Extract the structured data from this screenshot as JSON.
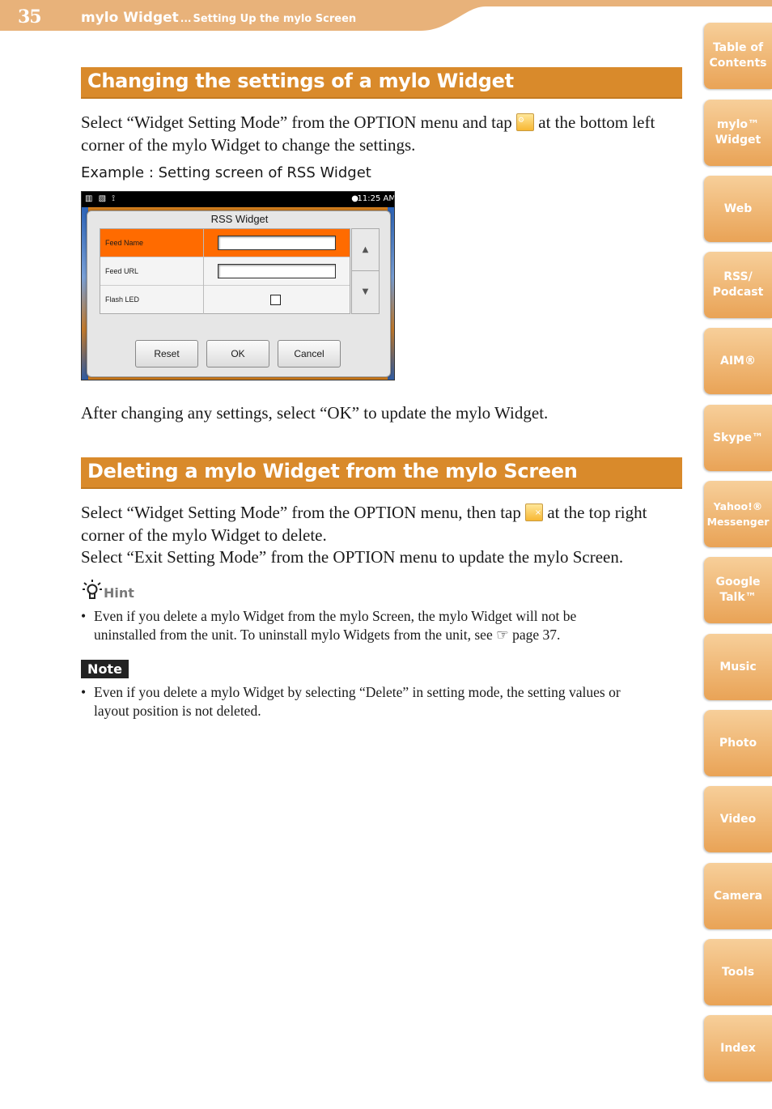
{
  "header": {
    "page_number": "35",
    "section": "mylo Widget",
    "separator": "...",
    "subsection": "Setting Up the mylo Screen"
  },
  "section1": {
    "title": "Changing the settings of a mylo Widget",
    "text_before_icon": "Select “Widget Setting Mode” from the OPTION menu and tap",
    "text_after_icon": "at the bottom left corner of the mylo Widget to change the settings.",
    "example_caption": "Example : Setting screen of RSS Widget",
    "after_text": "After changing any settings, select “OK” to update the mylo Widget."
  },
  "screenshot": {
    "status_icons": "▥ ▧ ⟟",
    "time": "11:25 AM",
    "chat_icon": "💬",
    "dialog_title": "RSS Widget",
    "rows": [
      {
        "label": "Feed Name",
        "selected": true
      },
      {
        "label": "Feed URL",
        "selected": false
      },
      {
        "label": "Flash LED",
        "selected": false
      }
    ],
    "scroll_up": "▲",
    "scroll_down": "▼",
    "buttons": {
      "reset": "Reset",
      "ok": "OK",
      "cancel": "Cancel"
    }
  },
  "section2": {
    "title": "Deleting a mylo Widget from the mylo Screen",
    "text_before_icon": "Select “Widget Setting Mode” from the OPTION menu, then tap",
    "text_after_icon": "at the top right corner of the mylo Widget to delete.",
    "text_line3": "Select “Exit Setting Mode” from the OPTION menu to update the mylo Screen."
  },
  "hint": {
    "label": "Hint",
    "bullet_line1": "Even if  you delete a mylo Widget from the mylo Screen, the mylo Widget will not be",
    "bullet_line2": "uninstalled from the unit. To uninstall mylo Widgets from the unit, see ☞ page 37."
  },
  "note": {
    "label": "Note",
    "bullet_line1": "Even if you delete a mylo Widget by selecting “Delete” in setting mode, the setting values or",
    "bullet_line2": "layout position is not deleted."
  },
  "tabs": [
    "Table of\nContents",
    "mylo™\nWidget",
    "Web",
    "RSS/\nPodcast",
    "AIM®",
    "Skype™",
    "Yahoo!®\nMessenger",
    "Google\nTalk™",
    "Music",
    "Photo",
    "Video",
    "Camera",
    "Tools",
    "Index"
  ],
  "colors": {
    "accent": "#d98a2b",
    "header_band": "#e8b27a",
    "tab": "#f0b878",
    "selected_row": "#ff6b00"
  }
}
